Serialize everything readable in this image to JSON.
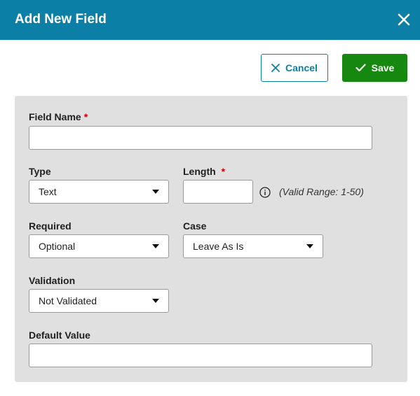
{
  "dialog": {
    "title": "Add New Field",
    "close_icon": "close-icon"
  },
  "toolbar": {
    "cancel_label": "Cancel",
    "cancel_icon": "x-icon",
    "save_label": "Save",
    "save_icon": "checkmark-icon"
  },
  "form": {
    "field_name": {
      "label": "Field Name",
      "required_mark": "*",
      "value": ""
    },
    "type": {
      "label": "Type",
      "selected": "Text"
    },
    "length": {
      "label": "Length",
      "required_mark": "*",
      "value": "",
      "hint": "(Valid Range: 1-50)",
      "info_icon": "info-icon"
    },
    "required": {
      "label": "Required",
      "selected": "Optional"
    },
    "case": {
      "label": "Case",
      "selected": "Leave As Is"
    },
    "validation": {
      "label": "Validation",
      "selected": "Not Validated"
    },
    "default_value": {
      "label": "Default Value",
      "value": ""
    }
  },
  "colors": {
    "header": "#0b7fa5",
    "save": "#16870f",
    "panel": "#e0e0e0",
    "required": "#cc0000"
  }
}
